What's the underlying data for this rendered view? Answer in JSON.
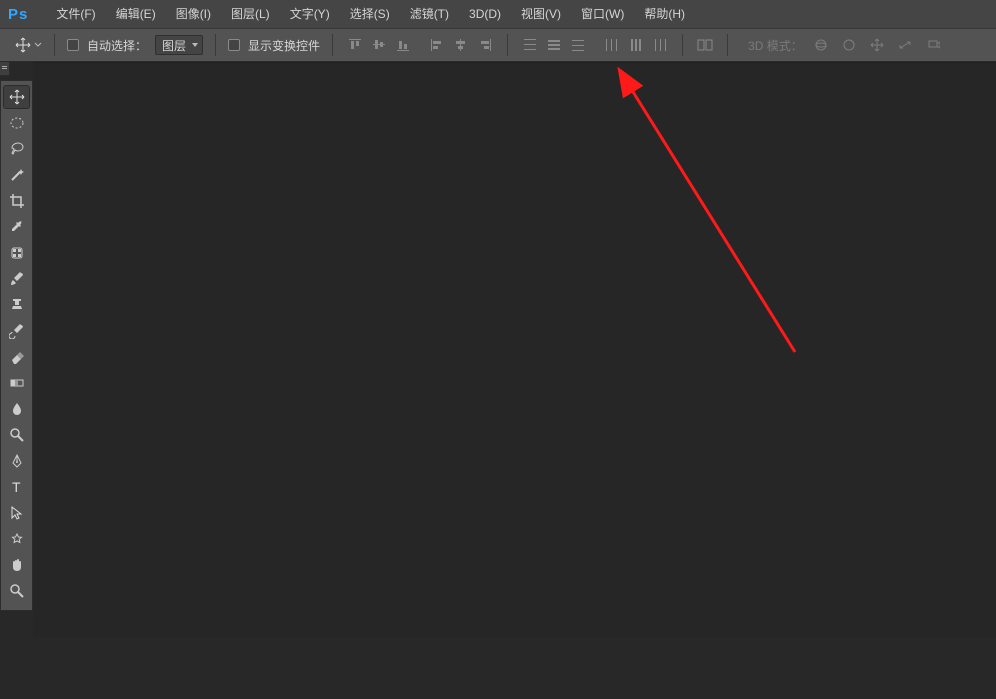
{
  "app": {
    "logo": "Ps"
  },
  "menu": [
    {
      "label": "文件(F)"
    },
    {
      "label": "编辑(E)"
    },
    {
      "label": "图像(I)"
    },
    {
      "label": "图层(L)"
    },
    {
      "label": "文字(Y)"
    },
    {
      "label": "选择(S)"
    },
    {
      "label": "滤镜(T)"
    },
    {
      "label": "3D(D)"
    },
    {
      "label": "视图(V)"
    },
    {
      "label": "窗口(W)"
    },
    {
      "label": "帮助(H)"
    }
  ],
  "options": {
    "auto_select_label": "自动选择：",
    "layer_dropdown": "图层",
    "show_transform_label": "显示变换控件",
    "mode3d_label": "3D 模式："
  },
  "tools": [
    {
      "name": "move-tool"
    },
    {
      "name": "marquee-tool"
    },
    {
      "name": "lasso-tool"
    },
    {
      "name": "magic-wand-tool"
    },
    {
      "name": "crop-tool"
    },
    {
      "name": "eyedropper-tool"
    },
    {
      "name": "healing-brush-tool"
    },
    {
      "name": "brush-tool"
    },
    {
      "name": "clone-stamp-tool"
    },
    {
      "name": "history-brush-tool"
    },
    {
      "name": "eraser-tool"
    },
    {
      "name": "gradient-tool"
    },
    {
      "name": "blur-tool"
    },
    {
      "name": "dodge-tool"
    },
    {
      "name": "pen-tool"
    },
    {
      "name": "type-tool"
    },
    {
      "name": "path-selection-tool"
    },
    {
      "name": "shape-tool"
    },
    {
      "name": "hand-tool"
    },
    {
      "name": "zoom-tool"
    }
  ]
}
